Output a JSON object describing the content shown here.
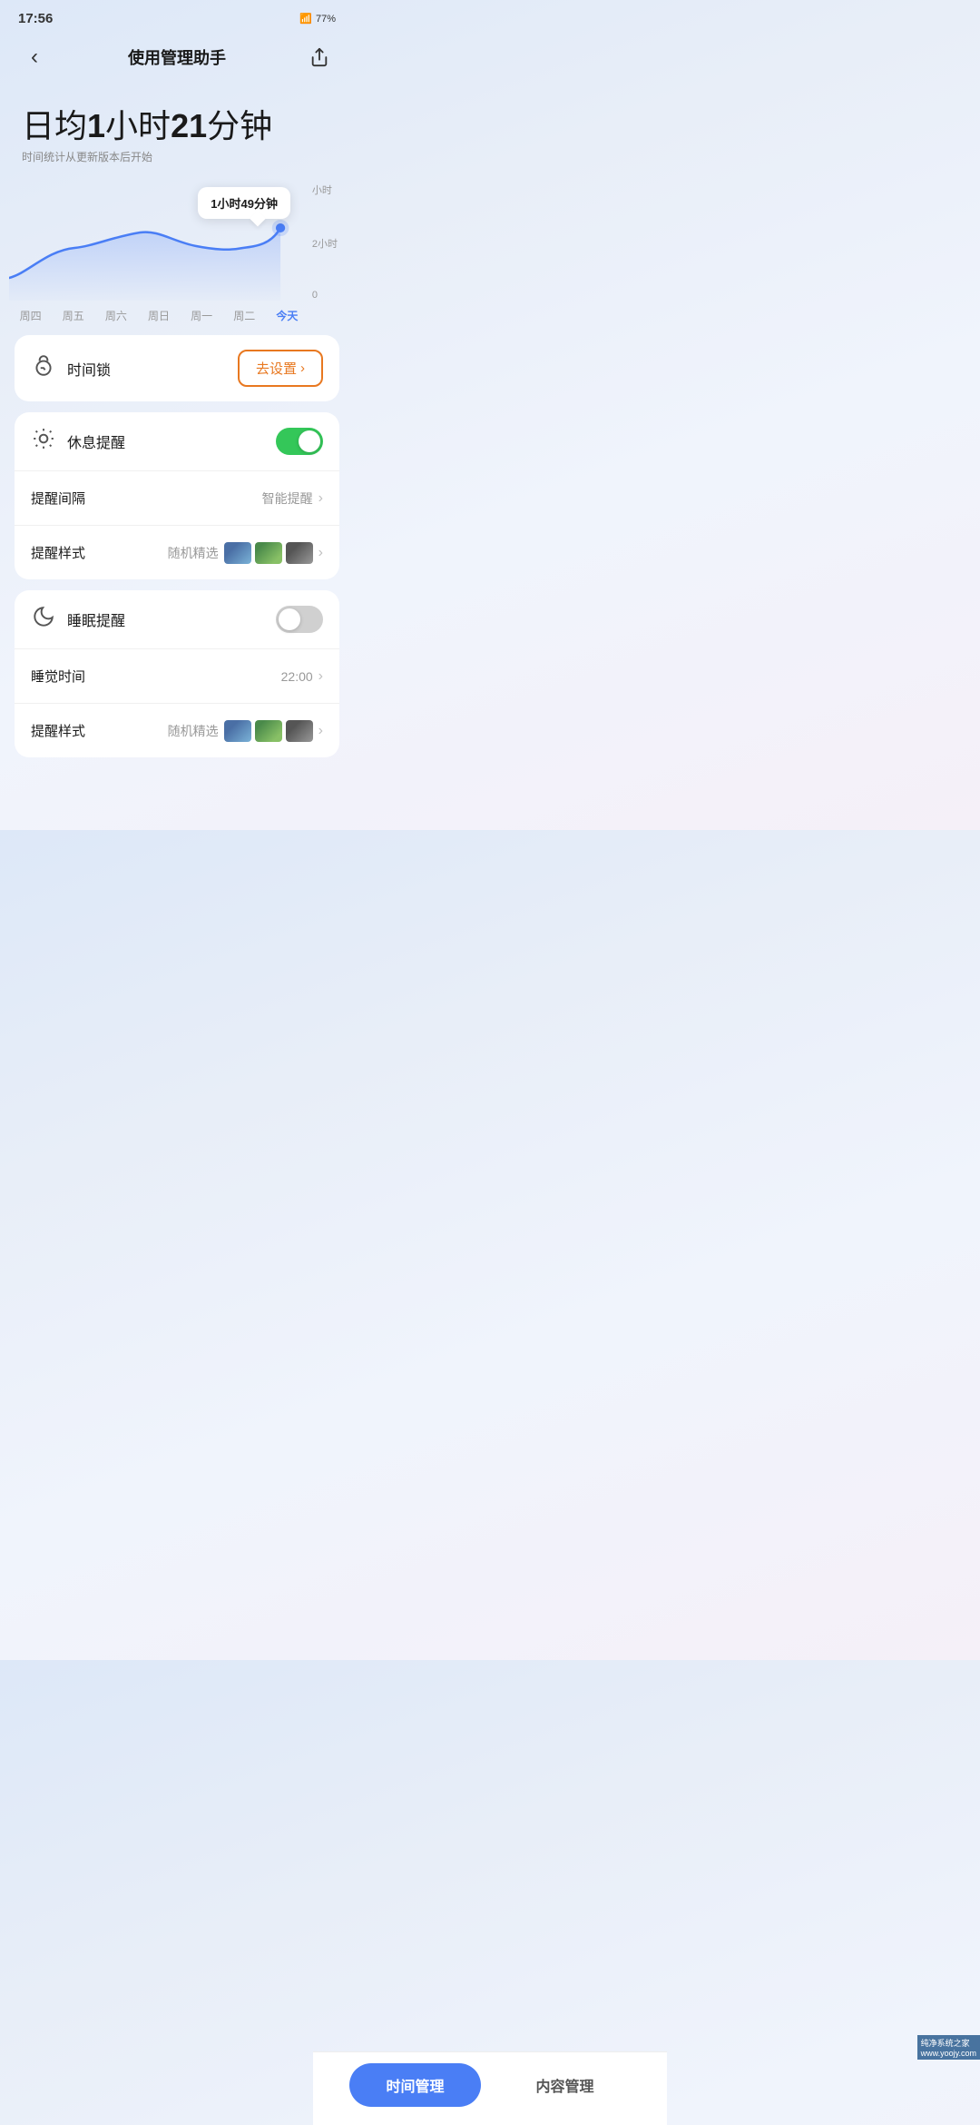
{
  "statusBar": {
    "time": "17:56",
    "battery": "77%",
    "batteryIcon": "🔋"
  },
  "header": {
    "title": "使用管理助手",
    "backIcon": "‹",
    "shareIcon": "↗"
  },
  "stats": {
    "prefix": "日均",
    "hours": "1",
    "hoursUnit": "小时",
    "minutes": "21",
    "minutesUnit": "分钟",
    "subtitle": "时间统计从更新版本后开始"
  },
  "chart": {
    "tooltip": "1小时49分钟",
    "yLabels": [
      "小时",
      "2小时",
      "0"
    ],
    "xLabels": [
      "周四",
      "周五",
      "周六",
      "周日",
      "周一",
      "周二",
      "今天"
    ],
    "dotValue": "●"
  },
  "timeLock": {
    "icon": "⏰",
    "label": "时间锁",
    "buttonLabel": "去设置",
    "buttonChevron": "›"
  },
  "restReminder": {
    "icon": "⏱",
    "label": "休息提醒",
    "toggleOn": true
  },
  "reminderInterval": {
    "label": "提醒间隔",
    "value": "智能提醒",
    "chevron": "›"
  },
  "reminderStyle": {
    "label": "提醒样式",
    "value": "随机精选",
    "chevron": "›"
  },
  "sleepReminder": {
    "icon": "🌙",
    "label": "睡眠提醒",
    "toggleOn": false
  },
  "sleepTime": {
    "label": "睡觉时间",
    "value": "22:00",
    "chevron": "›"
  },
  "reminderStyle2": {
    "label": "提醒样式",
    "value": "随机精选",
    "chevron": "›"
  },
  "tabBar": {
    "tab1": "时间管理",
    "tab2": "内容管理"
  },
  "watermark": "纯净系统之家\nwww.yoojy.com"
}
